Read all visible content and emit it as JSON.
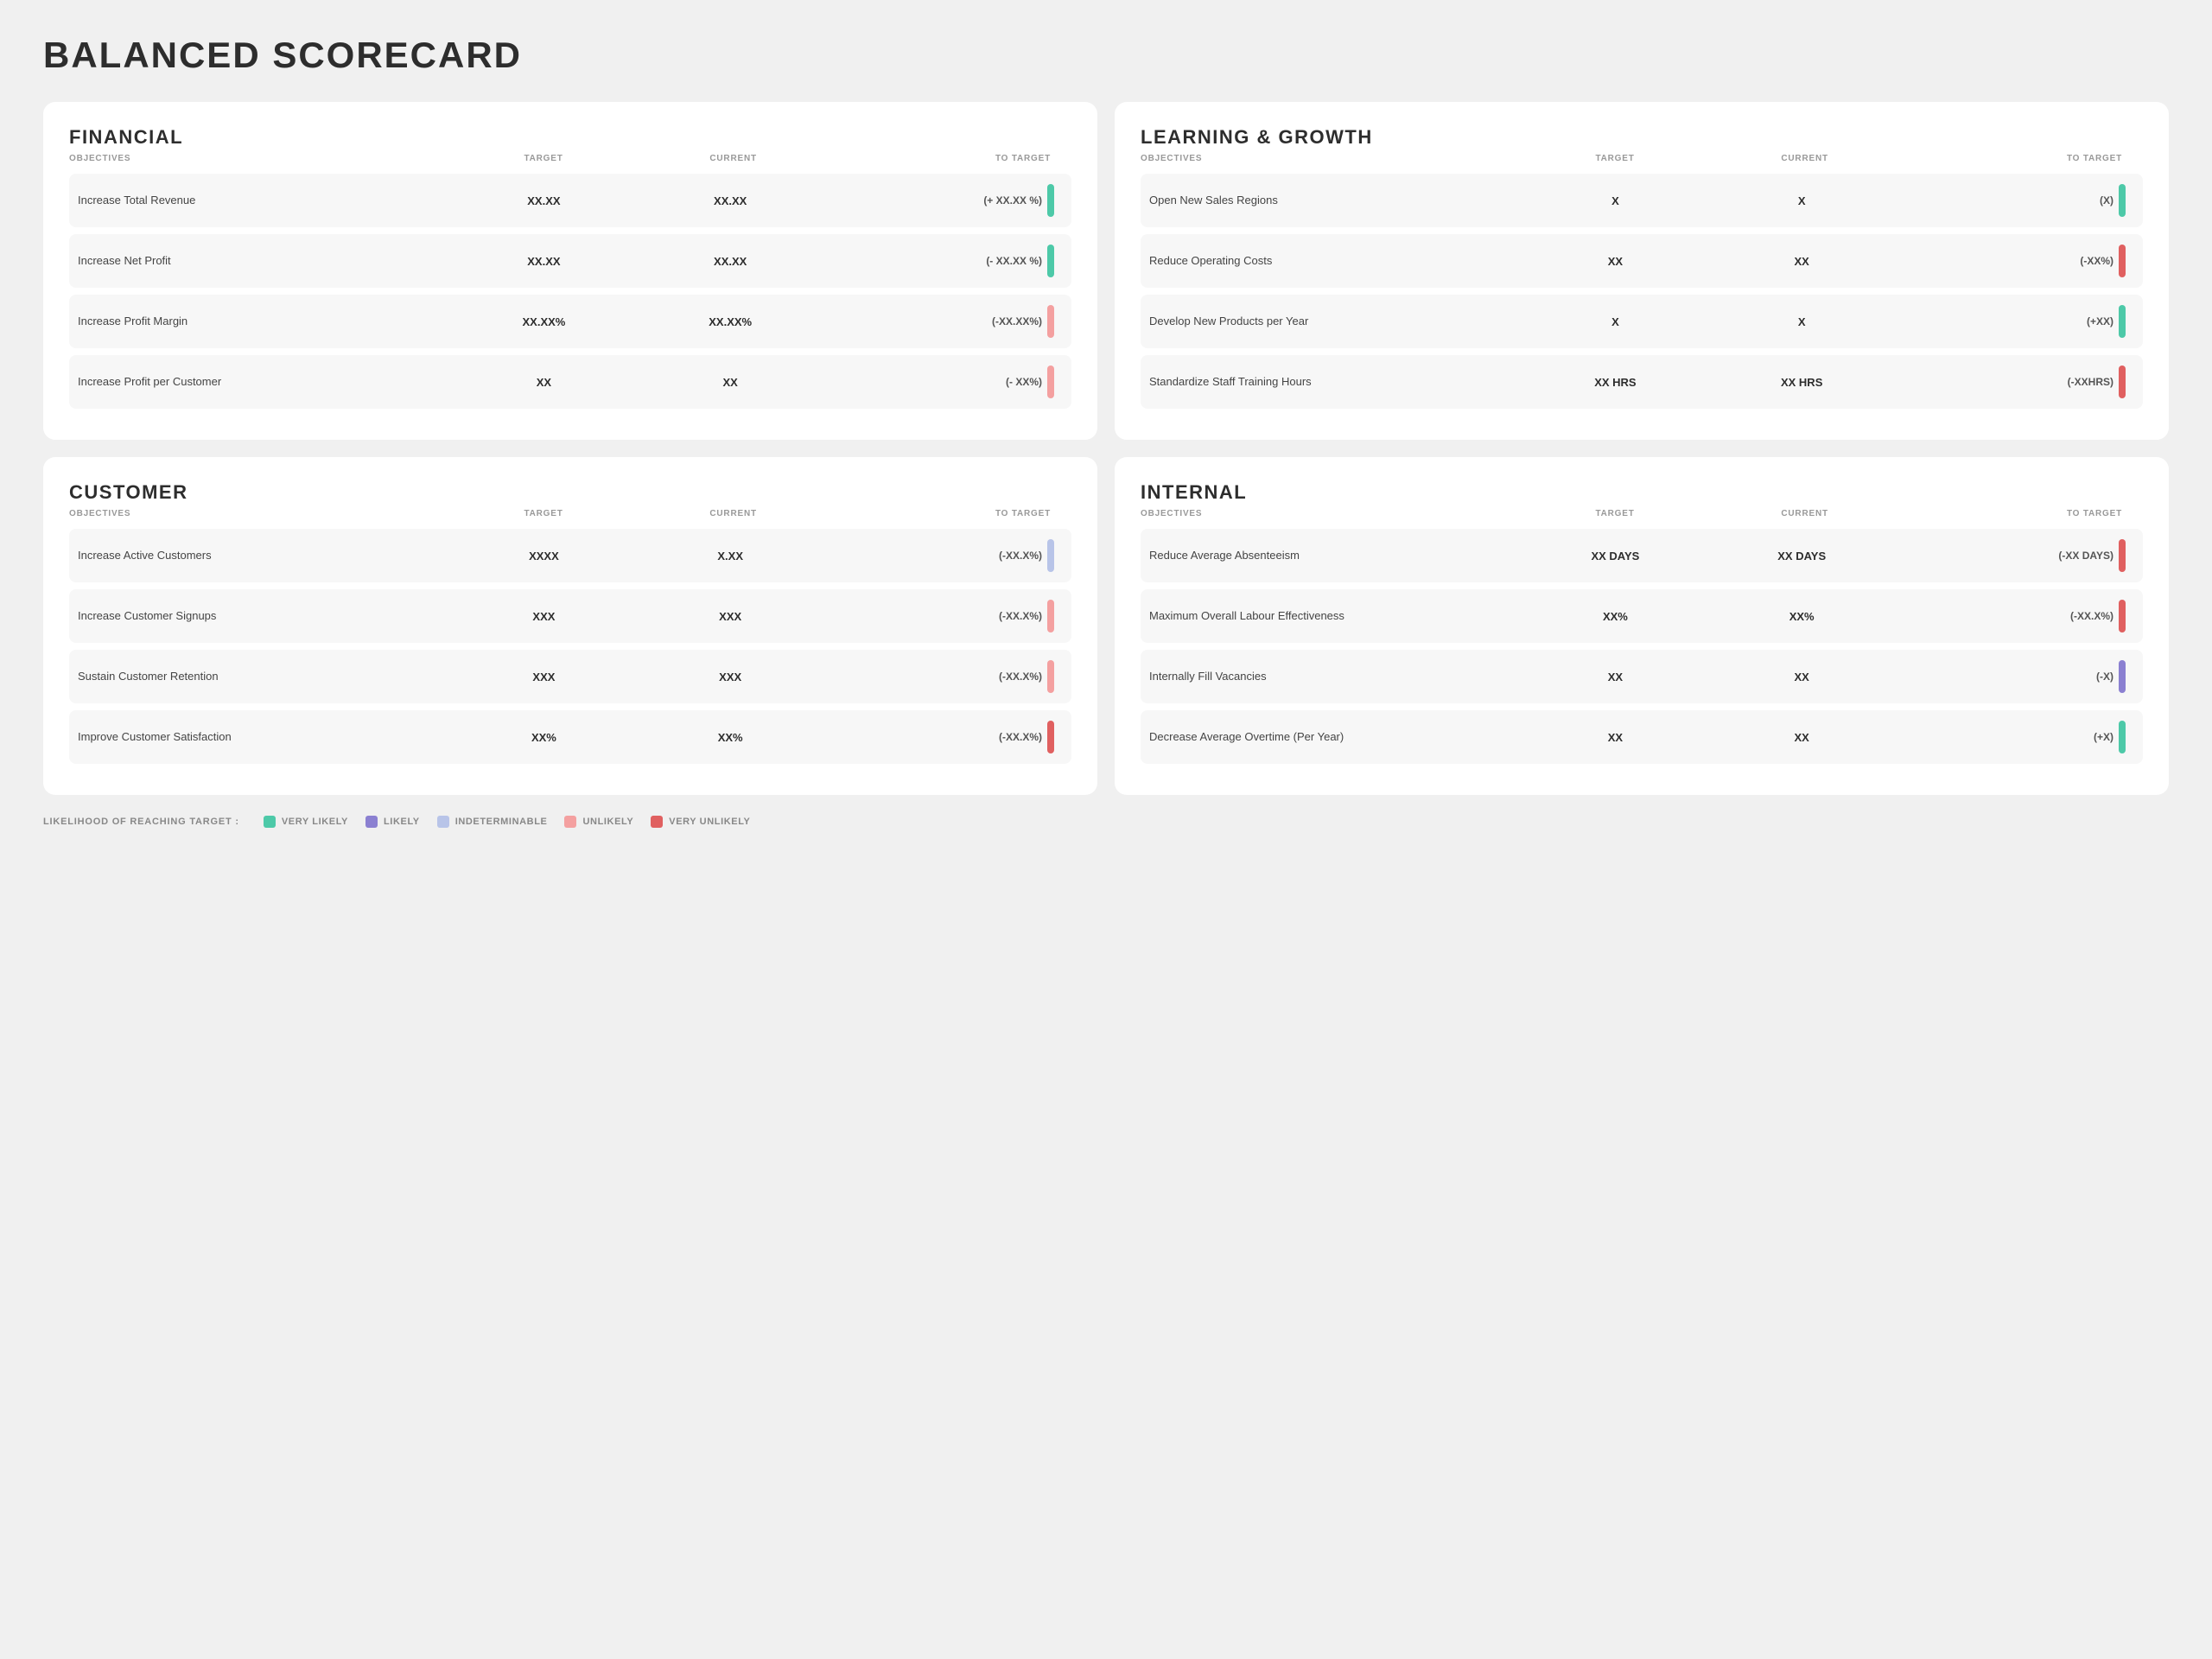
{
  "title": "BALANCED SCORECARD",
  "legend": {
    "prefix": "LIKELIHOOD OF REACHING TARGET :",
    "items": [
      {
        "label": "VERY LIKELY",
        "color": "#4dc9a8"
      },
      {
        "label": "LIKELY",
        "color": "#8b80d1"
      },
      {
        "label": "INDETERMINABLE",
        "color": "#b8c4e8"
      },
      {
        "label": "UNLIKELY",
        "color": "#f4a0a0"
      },
      {
        "label": "VERY UNLIKELY",
        "color": "#e06060"
      }
    ]
  },
  "sections": [
    {
      "id": "financial",
      "title": "FINANCIAL",
      "headers": {
        "objectives": "OBJECTIVES",
        "target": "TARGET",
        "current": "CURRENT",
        "to_target": "TO TARGET"
      },
      "rows": [
        {
          "objective": "Increase Total Revenue",
          "target": "XX.XX",
          "current": "XX.XX",
          "to_target": "(+ XX.XX %)",
          "bar_class": "bar-very-likely"
        },
        {
          "objective": "Increase Net Profit",
          "target": "XX.XX",
          "current": "XX.XX",
          "to_target": "(- XX.XX %)",
          "bar_class": "bar-very-likely"
        },
        {
          "objective": "Increase Profit Margin",
          "target": "XX.XX%",
          "current": "XX.XX%",
          "to_target": "(-XX.XX%)",
          "bar_class": "bar-unlikely"
        },
        {
          "objective": "Increase Profit per Customer",
          "target": "XX",
          "current": "XX",
          "to_target": "(- XX%)",
          "bar_class": "bar-unlikely"
        }
      ]
    },
    {
      "id": "learning",
      "title": "LEARNING & GROWTH",
      "headers": {
        "objectives": "OBJECTIVES",
        "target": "TARGET",
        "current": "CURRENT",
        "to_target": "TO TARGET"
      },
      "rows": [
        {
          "objective": "Open New Sales Regions",
          "target": "X",
          "current": "X",
          "to_target": "(X)",
          "bar_class": "bar-very-likely"
        },
        {
          "objective": "Reduce Operating Costs",
          "target": "XX",
          "current": "XX",
          "to_target": "(-XX%)",
          "bar_class": "bar-very-unlikely"
        },
        {
          "objective": "Develop New Products per Year",
          "target": "X",
          "current": "X",
          "to_target": "(+XX)",
          "bar_class": "bar-very-likely"
        },
        {
          "objective": "Standardize Staff Training Hours",
          "target": "XX HRS",
          "current": "XX HRS",
          "to_target": "(-XXHRS)",
          "bar_class": "bar-very-unlikely"
        }
      ]
    },
    {
      "id": "customer",
      "title": "CUSTOMER",
      "headers": {
        "objectives": "OBJECTIVES",
        "target": "TARGET",
        "current": "CURRENT",
        "to_target": "TO TARGET"
      },
      "rows": [
        {
          "objective": "Increase Active Customers",
          "target": "XXXX",
          "current": "X.XX",
          "to_target": "(-XX.X%)",
          "bar_class": "bar-indeterminable"
        },
        {
          "objective": "Increase Customer Signups",
          "target": "XXX",
          "current": "XXX",
          "to_target": "(-XX.X%)",
          "bar_class": "bar-unlikely"
        },
        {
          "objective": "Sustain Customer Retention",
          "target": "XXX",
          "current": "XXX",
          "to_target": "(-XX.X%)",
          "bar_class": "bar-unlikely"
        },
        {
          "objective": "Improve Customer Satisfaction",
          "target": "XX%",
          "current": "XX%",
          "to_target": "(-XX.X%)",
          "bar_class": "bar-very-unlikely"
        }
      ]
    },
    {
      "id": "internal",
      "title": "INTERNAL",
      "headers": {
        "objectives": "OBJECTIVES",
        "target": "TARGET",
        "current": "CURRENT",
        "to_target": "TO TARGET"
      },
      "rows": [
        {
          "objective": "Reduce Average Absenteeism",
          "target": "XX DAYS",
          "current": "XX DAYS",
          "to_target": "(-XX DAYS)",
          "bar_class": "bar-very-unlikely"
        },
        {
          "objective": "Maximum Overall Labour Effectiveness",
          "target": "XX%",
          "current": "XX%",
          "to_target": "(-XX.X%)",
          "bar_class": "bar-very-unlikely"
        },
        {
          "objective": "Internally Fill Vacancies",
          "target": "XX",
          "current": "XX",
          "to_target": "(-X)",
          "bar_class": "bar-likely"
        },
        {
          "objective": "Decrease Average Overtime (Per Year)",
          "target": "XX",
          "current": "XX",
          "to_target": "(+X)",
          "bar_class": "bar-very-likely"
        }
      ]
    }
  ]
}
